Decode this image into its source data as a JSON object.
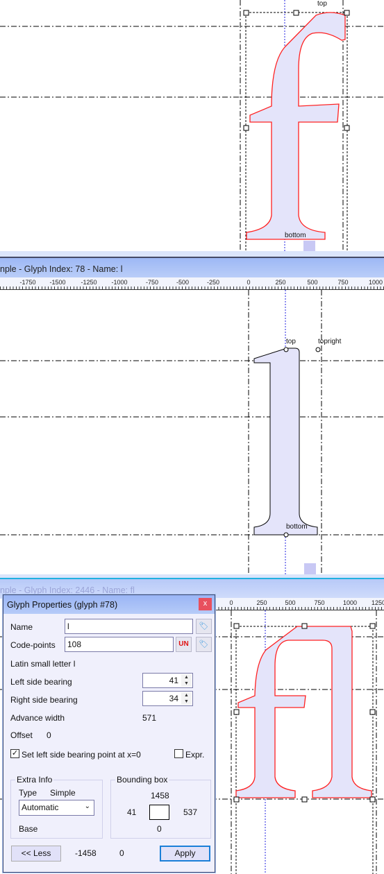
{
  "panel_top": {
    "glyph": "f",
    "anchors": {
      "top": "top",
      "bottom": "bottom"
    }
  },
  "panel_middle": {
    "title": "nple - Glyph Index: 78 - Name: l",
    "ruler_labels": [
      "-1750",
      "-1500",
      "-1250",
      "-1000",
      "-750",
      "-500",
      "-250",
      "0",
      "250",
      "500",
      "750",
      "1000"
    ],
    "anchors": {
      "top": "top",
      "topright": "topright",
      "bottom": "bottom"
    }
  },
  "panel_bottom": {
    "title": "nple - Glyph Index: 2446 - Name: fl",
    "ruler_labels": [
      "0",
      "250",
      "500",
      "750",
      "1000",
      "1250"
    ]
  },
  "dialog": {
    "title": "Glyph Properties (glyph #78)",
    "close_label": "x",
    "name_label": "Name",
    "name_value": "l",
    "codepoints_label": "Code-points",
    "codepoints_value": "108",
    "unicode_icon_label": "UN",
    "char_description": "Latin small letter l",
    "lsb_label": "Left side bearing",
    "lsb_value": "41",
    "rsb_label": "Right side bearing",
    "rsb_value": "34",
    "advance_label": "Advance width",
    "advance_value": "571",
    "offset_label": "Offset",
    "offset_value": "0",
    "set_lsb_label": "Set left side bearing point at x=0",
    "set_lsb_checked": true,
    "expr_label": "Expr.",
    "expr_checked": false,
    "extra_info": {
      "title": "Extra Info",
      "type_label": "Type",
      "type_value": "Simple",
      "select_value": "Automatic",
      "base_label": "Base"
    },
    "bounding_box": {
      "title": "Bounding box",
      "top": "1458",
      "left": "41",
      "right": "537",
      "bottom": "0"
    },
    "less_button": "<< Less",
    "footer_value_1": "-1458",
    "footer_value_2": "0",
    "apply_button": "Apply"
  },
  "colors": {
    "outline_selected": "#ff2020",
    "glyph_fill": "#e4e4fa",
    "baseline_marker": "#2020e0",
    "titlebar": "#a8c0f6"
  }
}
